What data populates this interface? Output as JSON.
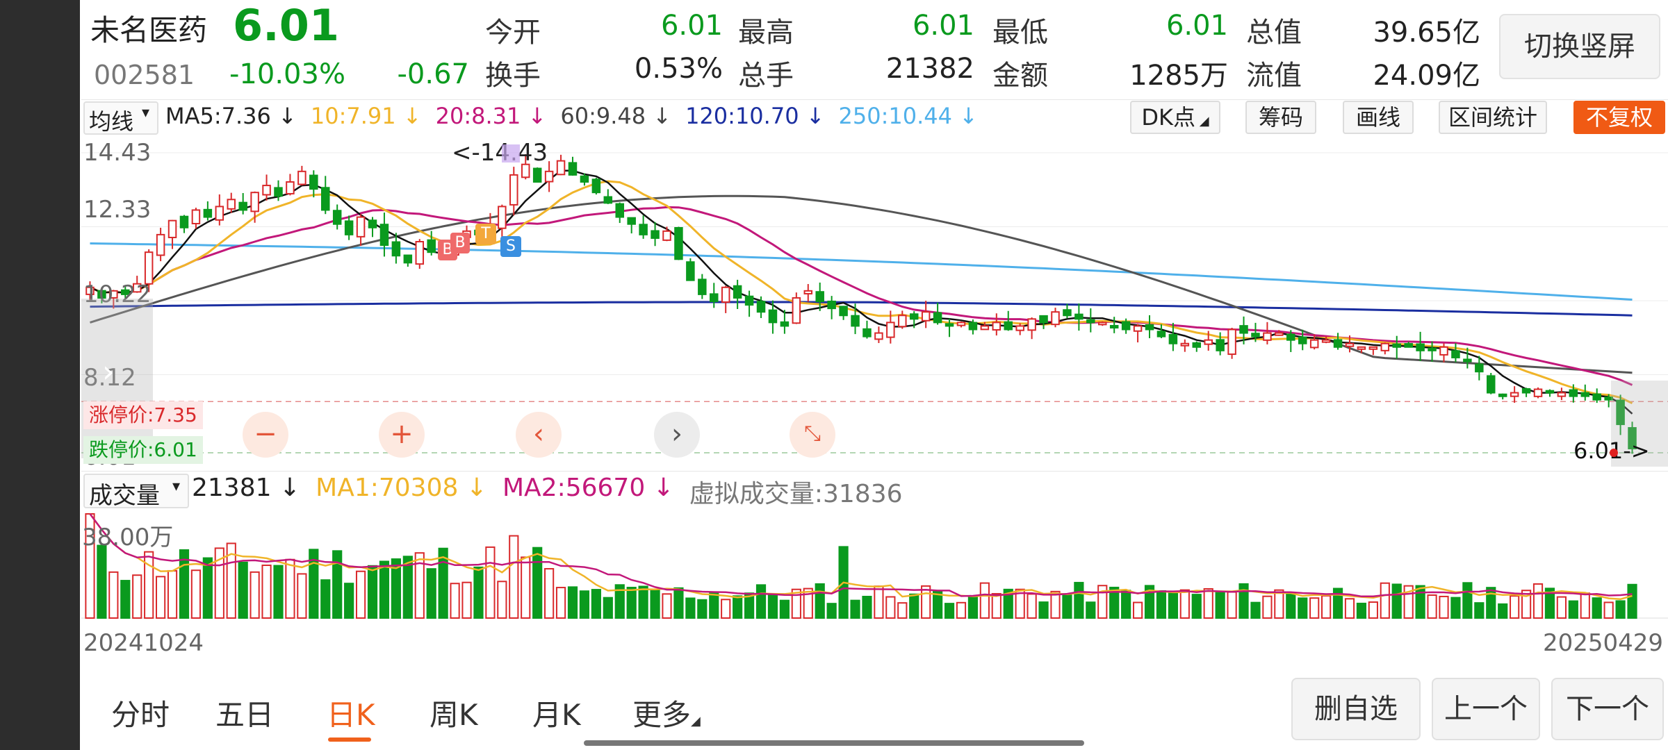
{
  "stock": {
    "name": "未名医药",
    "code": "002581",
    "price": "6.01",
    "change_pct": "-10.03%",
    "change": "-0.67"
  },
  "quote": [
    {
      "label": "今开",
      "value": "6.01"
    },
    {
      "label": "最高",
      "value": "6.01"
    },
    {
      "label": "最低",
      "value": "6.01"
    },
    {
      "label": "总值",
      "value": "39.65亿"
    },
    {
      "label": "换手",
      "value": "0.53%"
    },
    {
      "label": "总手",
      "value": "21382"
    },
    {
      "label": "金额",
      "value": "1285万"
    },
    {
      "label": "流值",
      "value": "24.09亿"
    }
  ],
  "switch_label": "切换竖屏",
  "ma_row": {
    "selector": "均线",
    "items": [
      {
        "text": "MA5:7.36 ↓",
        "color": "#222222"
      },
      {
        "text": "10:7.91 ↓",
        "color": "#f0b429"
      },
      {
        "text": "20:8.31 ↓",
        "color": "#c2187a"
      },
      {
        "text": "60:9.48 ↓",
        "color": "#444444"
      },
      {
        "text": "120:10.70 ↓",
        "color": "#1a2ea0"
      },
      {
        "text": "250:10.44 ↓",
        "color": "#4fb0ea"
      }
    ]
  },
  "tools": {
    "dk": "DK点",
    "chip": "筹码",
    "draw": "画线",
    "range": "区间统计",
    "fq": "不复权"
  },
  "price_axis": [
    "14.43",
    "12.33",
    "10.22",
    "8.12",
    "6.01"
  ],
  "markers": {
    "high_label": "<-14.43",
    "last_label": "6.01->",
    "limit_up": "涨停价:7.35",
    "limit_down": "跌停价:6.01"
  },
  "bs_markers": [
    "B",
    "B",
    "T",
    "S"
  ],
  "volume_row": {
    "selector": "成交量",
    "items": [
      {
        "text": "21381 ↓",
        "color": "#222222"
      },
      {
        "text": "MA1:70308 ↓",
        "color": "#f0b429"
      },
      {
        "text": "MA2:56670 ↓",
        "color": "#c2187a"
      },
      {
        "text": "虚拟成交量:31836",
        "color": "#777777"
      }
    ],
    "axis_label": "38.00万"
  },
  "dates": {
    "start": "20241024",
    "end": "20250429"
  },
  "tabs": [
    "分时",
    "五日",
    "日K",
    "周K",
    "月K",
    "更多"
  ],
  "active_tab": "日K",
  "bottom_buttons": [
    "删自选",
    "上一个",
    "下一个"
  ],
  "colors": {
    "up": "#d9292b",
    "down": "#0a9a1e",
    "accent": "#f0611c"
  },
  "chart_data": {
    "type": "candlestick",
    "period_start": "20241024",
    "period_end": "20250429",
    "ylim": [
      6.01,
      14.43
    ],
    "closes": [
      10.6,
      10.3,
      10.5,
      10.4,
      10.7,
      11.6,
      12.1,
      12.5,
      12.3,
      12.8,
      12.6,
      12.9,
      13.1,
      12.8,
      13.3,
      13.5,
      13.2,
      13.6,
      13.9,
      13.4,
      12.8,
      12.4,
      12.1,
      12.6,
      12.3,
      11.8,
      11.5,
      11.3,
      11.9,
      11.6,
      11.5,
      11.9,
      12.2,
      12.1,
      12.4,
      12.9,
      13.8,
      14.1,
      13.6,
      13.9,
      14.2,
      13.8,
      13.6,
      13.3,
      13.0,
      12.6,
      12.4,
      12.1,
      12.0,
      12.2,
      11.4,
      10.8,
      10.4,
      10.2,
      10.6,
      10.3,
      10.1,
      9.9,
      9.6,
      9.5,
      10.3,
      10.5,
      10.2,
      10.0,
      9.8,
      9.5,
      9.2,
      9.3,
      9.6,
      9.8,
      9.7,
      9.9,
      9.6,
      9.5,
      9.6,
      9.4,
      9.5,
      9.6,
      9.4,
      9.5,
      9.7,
      9.6,
      9.9,
      9.8,
      9.7,
      9.6,
      9.6,
      9.5,
      9.4,
      9.5,
      9.4,
      9.2,
      9.0,
      9.0,
      8.9,
      9.1,
      8.8,
      9.4,
      9.3,
      9.2,
      9.3,
      9.3,
      9.1,
      9.0,
      9.1,
      9.1,
      8.9,
      9.0,
      8.9,
      8.9,
      9.0,
      8.9,
      8.9,
      8.8,
      8.8,
      8.9,
      8.6,
      8.5,
      8.2,
      7.6,
      7.5,
      7.6,
      7.6,
      7.7,
      7.6,
      7.6,
      7.5,
      7.5,
      7.4,
      7.4,
      6.7,
      6.01
    ],
    "price_lines": [
      "MA5",
      "MA10",
      "MA20",
      "MA60",
      "MA120",
      "MA250"
    ],
    "volume_series": [
      {
        "name": "成交量",
        "unit": "手"
      },
      {
        "name": "MA1",
        "value": 70308
      },
      {
        "name": "MA2",
        "value": 56670
      }
    ]
  }
}
